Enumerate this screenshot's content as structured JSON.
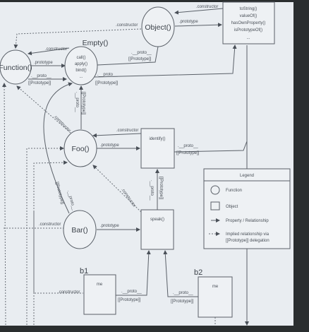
{
  "nodes": {
    "object": {
      "label": "Object()"
    },
    "function": {
      "label": "Function()"
    },
    "empty": {
      "label": "Empty()",
      "members": [
        "call()",
        "apply()",
        "bind()",
        "..."
      ]
    },
    "foo": {
      "label": "Foo()"
    },
    "bar": {
      "label": "Bar()"
    },
    "object_proto": {
      "members": [
        "toString()",
        "valueOf()",
        "hasOwnProperty()",
        "isPrototypeOf()",
        "..."
      ]
    },
    "foo_proto": {
      "members": [
        "identify()"
      ]
    },
    "bar_proto": {
      "members": [
        "speak()"
      ]
    },
    "b1": {
      "label": "b1",
      "members": [
        "me"
      ]
    },
    "b2": {
      "label": "b2",
      "members": [
        "me"
      ]
    }
  },
  "edge_labels": {
    "constructor": ".constructor",
    "prototype": ".prototype",
    "proto": ".__proto__",
    "proto_internal": "[[Prototype]]"
  },
  "legend": {
    "title": "Legend",
    "items": [
      "Function",
      "Object",
      "Property / Relationship",
      "Implied relationship via",
      "[[Prototype]] delegation"
    ]
  }
}
